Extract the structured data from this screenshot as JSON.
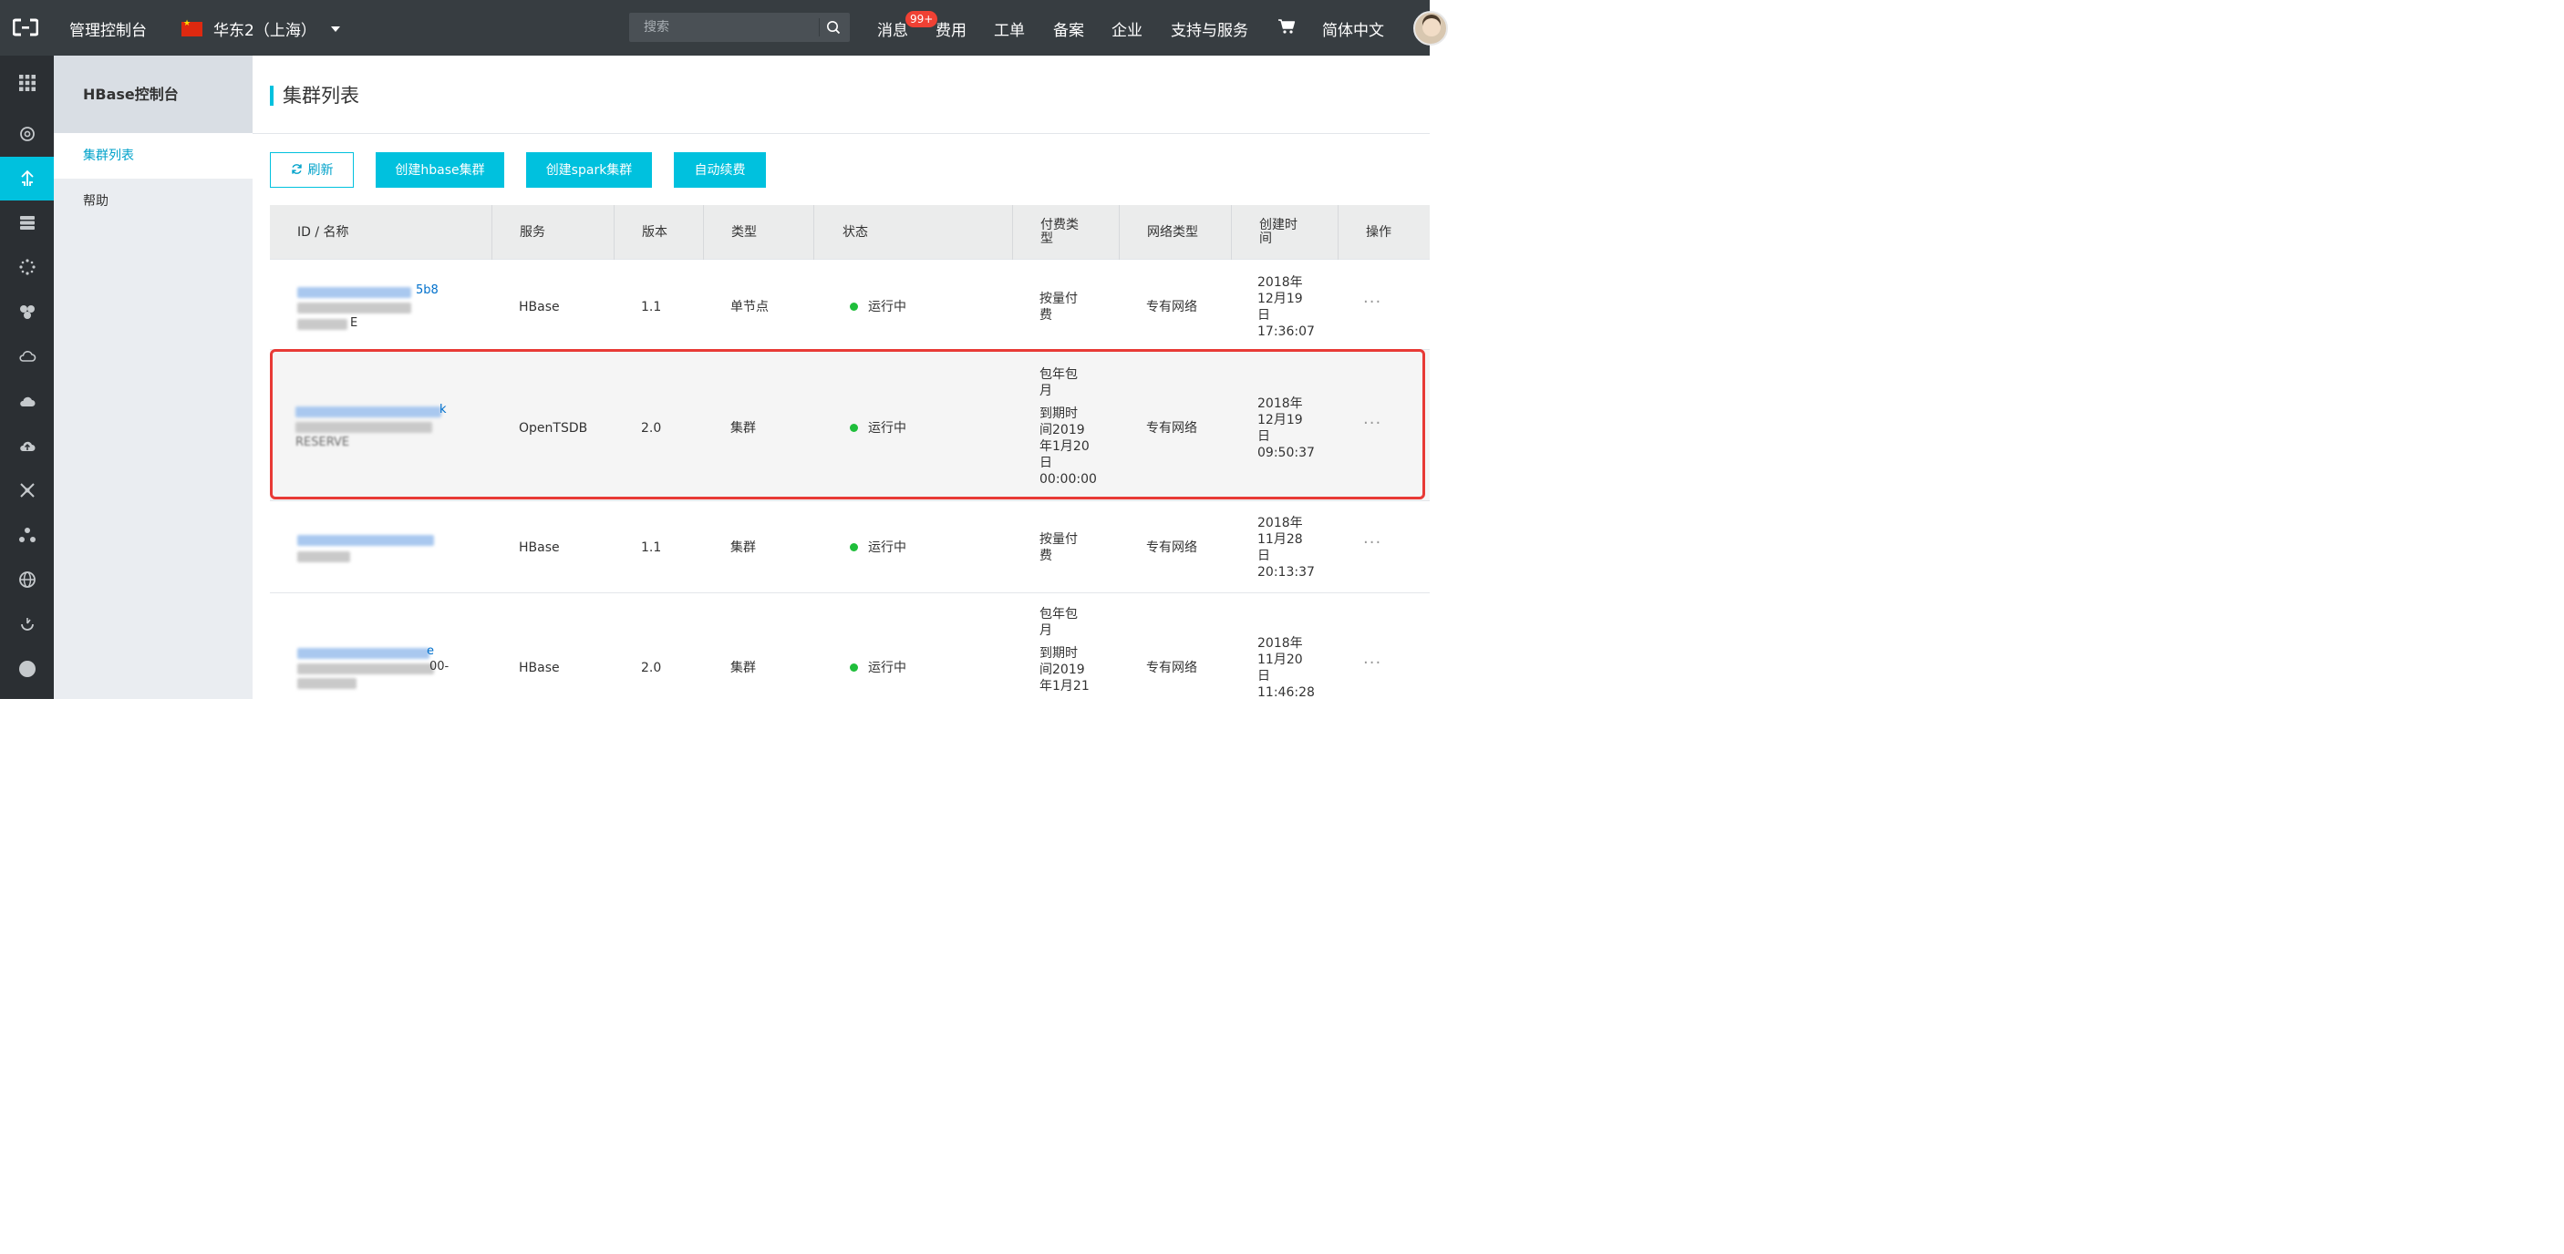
{
  "topbar": {
    "title": "管理控制台",
    "region": "华东2（上海）",
    "search_placeholder": "搜索",
    "messages": "消息",
    "messages_badge": "99+",
    "billing": "费用",
    "tickets": "工单",
    "icp": "备案",
    "enterprise": "企业",
    "support": "支持与服务",
    "language": "简体中文"
  },
  "sidebar": {
    "title": "HBase控制台",
    "items": [
      {
        "label": "集群列表",
        "active": true
      },
      {
        "label": "帮助",
        "active": false
      }
    ]
  },
  "page": {
    "title": "集群列表"
  },
  "toolbar": {
    "refresh": "刷新",
    "create_hbase": "创建hbase集群",
    "create_spark": "创建spark集群",
    "auto_renew": "自动续费"
  },
  "table": {
    "headers": [
      "ID / 名称",
      "服务",
      "版本",
      "类型",
      "状态",
      "付费类型",
      "网络类型",
      "创建时间",
      "操作"
    ],
    "rows": [
      {
        "id_visible_tail": "5b8",
        "name_visible_tail": "E",
        "service": "HBase",
        "version": "1.1",
        "type": "单节点",
        "status": "运行中",
        "billing": "按量付费",
        "billing_lines": [
          "按量付",
          "费"
        ],
        "network": "专有网络",
        "created_lines": [
          "2018年",
          "12月19",
          "日",
          "17:36:07"
        ],
        "more": "···"
      },
      {
        "id_visible_tail": "k",
        "name_visible_tail": "RESERVE",
        "service": "OpenTSDB",
        "version": "2.0",
        "type": "集群",
        "status": "运行中",
        "billing_lines": [
          "包年包",
          "月"
        ],
        "expiry_lines": [
          "到期时",
          "间2019",
          "年1月20",
          "日",
          "00:00:00"
        ],
        "network": "专有网络",
        "created_lines": [
          "2018年",
          "12月19",
          "日",
          "09:50:37"
        ],
        "more": "···"
      },
      {
        "service": "HBase",
        "version": "1.1",
        "type": "集群",
        "status": "运行中",
        "billing_lines": [
          "按量付",
          "费"
        ],
        "network": "专有网络",
        "created_lines": [
          "2018年",
          "11月28",
          "日",
          "20:13:37"
        ],
        "more": "···"
      },
      {
        "id_visible_tail": "e",
        "name_visible_tail": "00-",
        "service": "HBase",
        "version": "2.0",
        "type": "集群",
        "status": "运行中",
        "billing_lines": [
          "包年包",
          "月"
        ],
        "expiry_lines": [
          "到期时",
          "间2019",
          "年1月21"
        ],
        "network": "专有网络",
        "created_lines": [
          "2018年",
          "11月20",
          "日",
          "11:46:28"
        ],
        "more": "···"
      }
    ]
  },
  "colors": {
    "topbar_bg": "#373d41",
    "rail_bg": "#2b2f33",
    "accent": "#00c1de",
    "link": "#00a2ca",
    "status_running": "#1fbe3b",
    "highlight_border": "#e83a36"
  }
}
